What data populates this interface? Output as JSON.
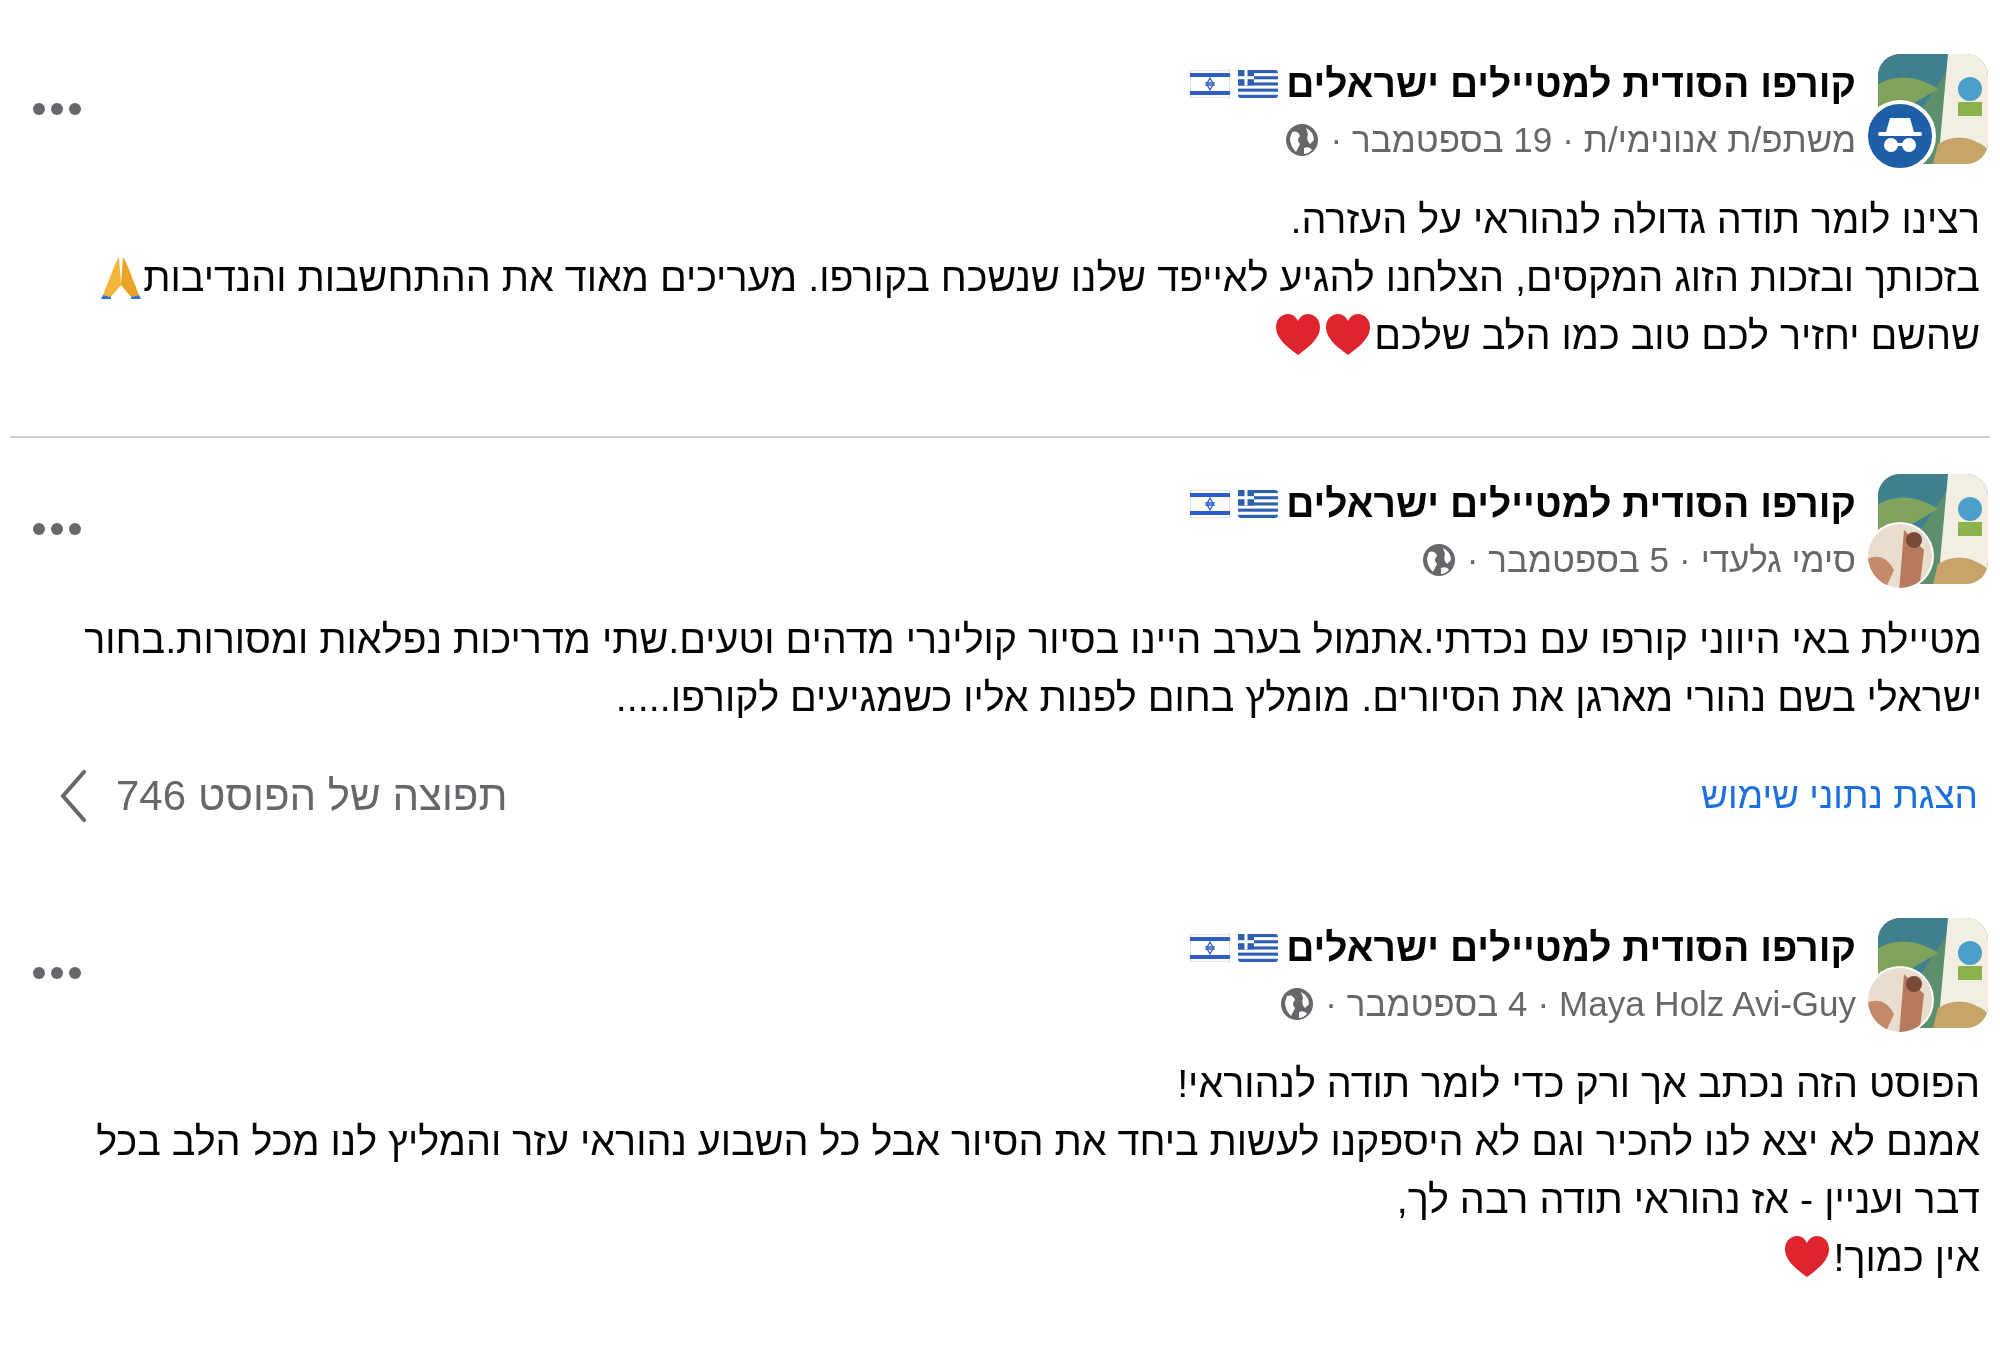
{
  "posts": [
    {
      "group": "קורפו הסודית למטיילים ישראלים",
      "avatar_badge": {
        "kind": "anonymous"
      },
      "meta": [
        "משתפ/ת אנונימי/ת",
        "·",
        "19 בספטמבר",
        "·"
      ],
      "lines": [
        {
          "text": "רצינו לומר תודה גדולה לנהוראי על העזרה."
        },
        {
          "text": "בזכותך ובזכות הזוג המקסים, הצלחנו להגיע לאייפד שלנו שנשכח בקורפו. מעריכים מאוד את ההתחשבות והנדיבות",
          "icons": [
            {
              "kind": "pray"
            }
          ]
        },
        {
          "text": "שהשם יחזיר לכם טוב כמו הלב שלכם",
          "icons": [
            {
              "kind": "heart"
            },
            {
              "kind": "heart"
            }
          ]
        }
      ]
    },
    {
      "group": "קורפו הסודית למטיילים ישראלים",
      "avatar_badge": {
        "kind": "picture"
      },
      "meta": [
        "סימי גלעדי",
        "·",
        "5 בספטמבר",
        "·"
      ],
      "lines": [
        {
          "text": "מטיילת באי היווני קורפו עם נכדתי.אתמול בערב היינו בסיור קולינרי מדהים וטעים.שתי מדריכות נפלאות ומסורות.בחור"
        },
        {
          "text": "ישראלי בשם נהורי מארגן את הסיורים. מומלץ בחום לפנות אליו כשמגיעים לקורפו....."
        }
      ],
      "footer": {
        "link": "הצגת נתוני שימוש",
        "reach_count": "746",
        "reach_label": "תפוצה של הפוסט"
      }
    },
    {
      "group": "קורפו הסודית למטיילים ישראלים",
      "avatar_badge": {
        "kind": "picture"
      },
      "meta": [
        "Maya Holz Avi-Guy",
        "·",
        "4 בספטמבר",
        "·"
      ],
      "lines": [
        {
          "text": "הפוסט הזה נכתב אך ורק כדי לומר תודה לנהוראי!"
        },
        {
          "text": "אמנם לא יצא לנו להכיר וגם לא היספקנו לעשות ביחד את הסיור אבל כל השבוע נהוראי עזר והמליץ לנו מכל הלב בכל"
        },
        {
          "text": "דבר ועניין - אז נהוראי תודה רבה לך,"
        },
        {
          "text": "אין כמוך!",
          "icons": [
            {
              "kind": "heart"
            }
          ]
        }
      ]
    }
  ]
}
